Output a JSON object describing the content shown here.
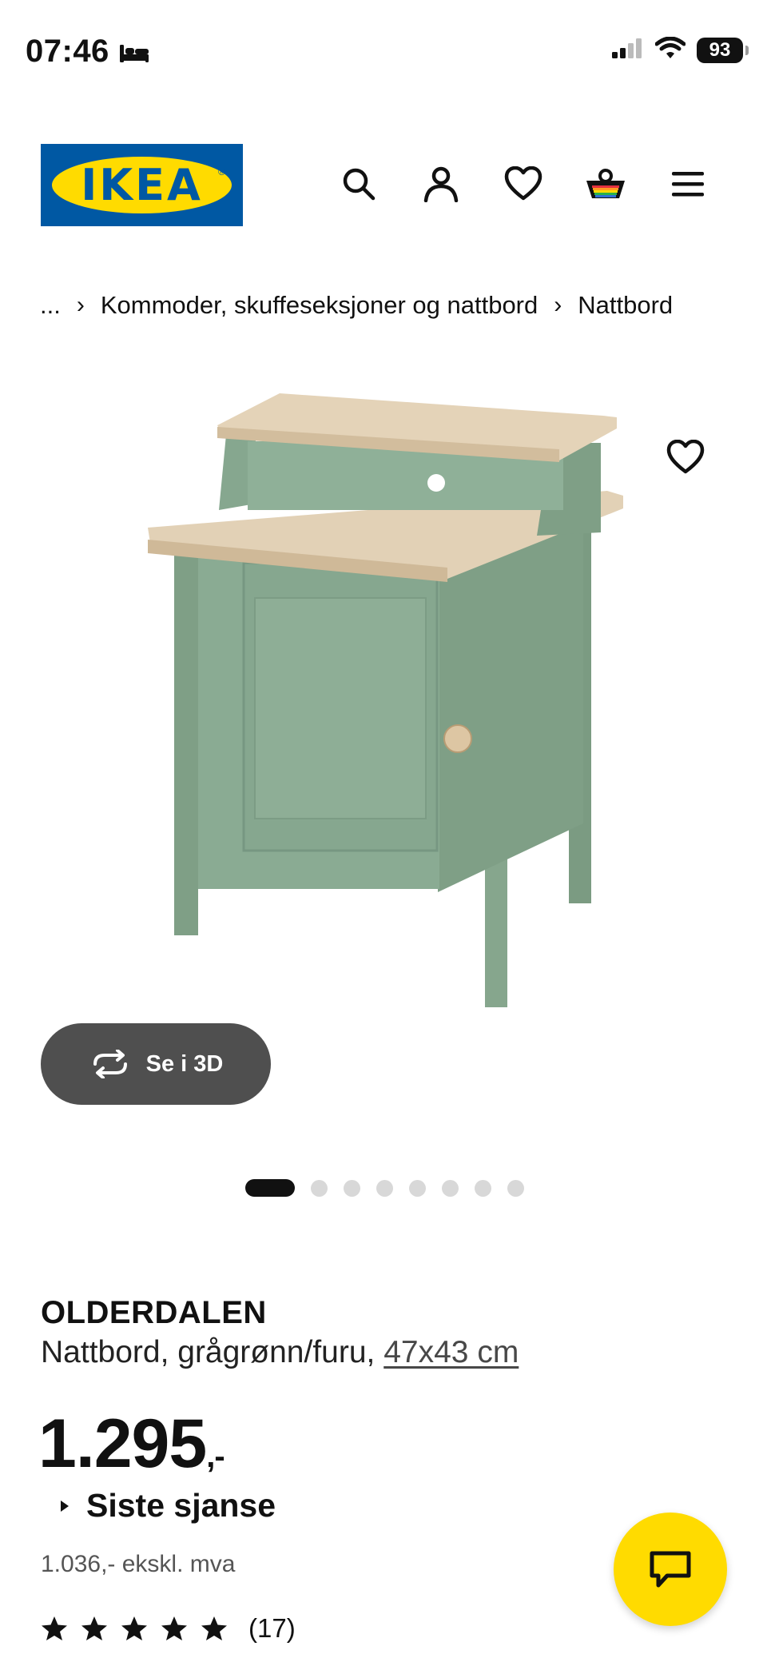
{
  "status_bar": {
    "time": "07:46",
    "battery": "93"
  },
  "header": {
    "logo_text": "IKEA"
  },
  "breadcrumb": {
    "ellipsis": "...",
    "items": [
      "Kommoder, skuffeseksjoner og nattbord",
      "Nattbord"
    ]
  },
  "gallery": {
    "view_3d_label": "Se i 3D",
    "dot_count": 8,
    "active_index": 0
  },
  "product": {
    "name": "OLDERDALEN",
    "description": "Nattbord, grågrønn/furu,",
    "size": "47x43 cm",
    "price_main": "1.295",
    "price_suffix": ",-",
    "promo_label": "Siste sjanse",
    "price_ex_vat": "1.036,- ekskl. mva",
    "rating_stars": 5,
    "rating_count": "(17)"
  },
  "colors": {
    "brand_blue": "#0058a3",
    "brand_yellow": "#ffdb00",
    "furniture_green": "#8aab93",
    "furniture_wood": "#e2d1b6"
  }
}
